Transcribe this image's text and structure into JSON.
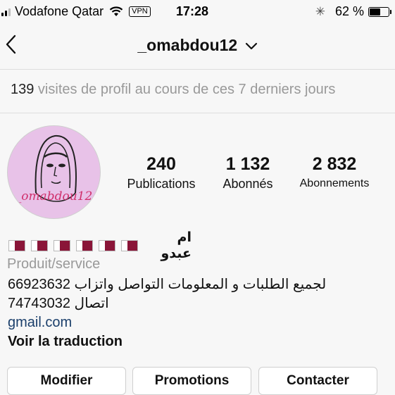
{
  "status_bar": {
    "carrier": "Vodafone Qatar",
    "vpn": "VPN",
    "time": "17:28",
    "battery_pct": "62 %",
    "battery_level": 0.62
  },
  "nav": {
    "title": "_omabdou12"
  },
  "visits": {
    "count": "139",
    "text": " visites de profil au cours de ces 7 derniers jours"
  },
  "profile": {
    "avatar_text": "_omabdou12",
    "stats": [
      {
        "value": "240",
        "label": "Publications"
      },
      {
        "value": "1 132",
        "label": "Abonnés"
      },
      {
        "value": "2 832",
        "label": "Abonnements"
      }
    ],
    "display_name": "ام عبدو",
    "flag_count": 6,
    "category": "Produit/service",
    "bio_line1": "لجميع الطلبات و المعلومات التواصل واتزاب 66923632",
    "bio_line2": "اتصال 74743032",
    "link": "gmail.com",
    "translate": "Voir la traduction"
  },
  "buttons": {
    "edit": "Modifier",
    "promotions": "Promotions",
    "contact": "Contacter"
  }
}
